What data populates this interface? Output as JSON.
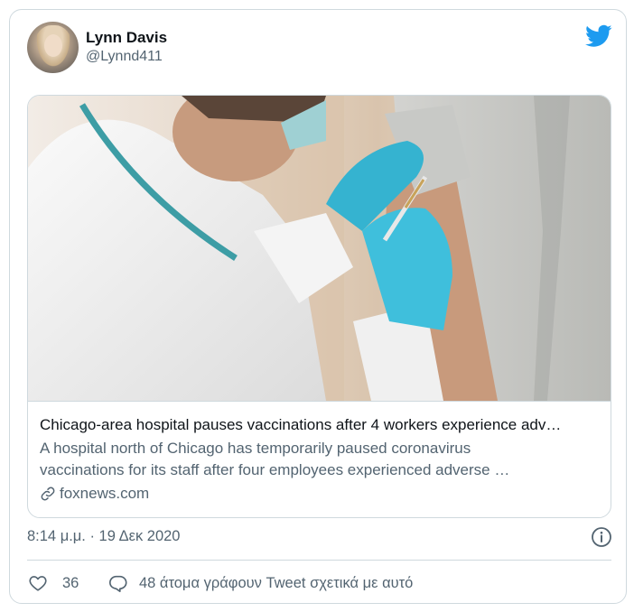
{
  "user": {
    "name": "Lynn Davis",
    "handle": "@Lynnd411"
  },
  "card": {
    "title": "Chicago-area hospital pauses vaccinations after 4 workers experience adv…",
    "description_line1": "A hospital north of Chicago has temporarily paused coronavirus",
    "description_line2": "vaccinations for its staff after four employees experienced adverse …",
    "domain": "foxnews.com"
  },
  "timestamp": "8:14 μ.μ. · 19 Δεκ 2020",
  "actions": {
    "likes_count": "36",
    "conversation_label": "48 άτομα γράφουν Tweet σχετικά με αυτό"
  },
  "icons": {
    "logo": "twitter-bird-icon",
    "info": "info-icon",
    "link": "link-icon",
    "like": "heart-icon",
    "reply": "reply-icon"
  },
  "colors": {
    "brand": "#1d9bf0",
    "secondary_text": "#536471",
    "border": "#cfd9de"
  }
}
